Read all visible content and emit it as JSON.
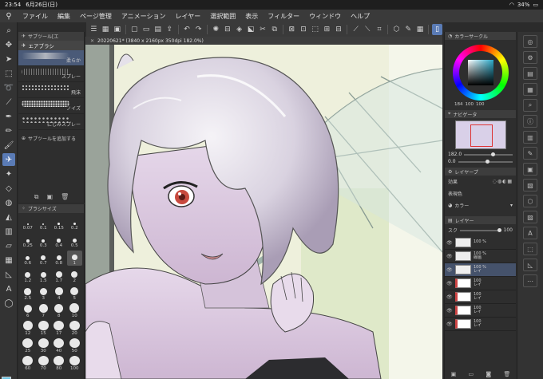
{
  "status": {
    "time": "23:54",
    "date": "6月26日(日)",
    "battery": "34%"
  },
  "menu": [
    "ファイル",
    "編集",
    "ページ管理",
    "アニメーション",
    "レイヤー",
    "選択範囲",
    "表示",
    "フィルター",
    "ウィンドウ",
    "ヘルプ"
  ],
  "subtool": {
    "header": "サブツール[エ",
    "group": "エアブラシ",
    "brushes": [
      {
        "label": "柔らか",
        "selected": true
      },
      {
        "label": "スプレー",
        "selected": false
      },
      {
        "label": "飛沫",
        "selected": false
      },
      {
        "label": "ノイズ",
        "selected": false
      },
      {
        "label": "にじみスプレー",
        "selected": false
      }
    ],
    "add_label": "サブツールを追加する"
  },
  "brush_size": {
    "header": "ブラシサイズ",
    "sizes": [
      "0.07",
      "0.1",
      "0.15",
      "0.2",
      "0.25",
      "0.3",
      "0.4",
      "0.5",
      "0.6",
      "0.7",
      "0.8",
      "1",
      "1.2",
      "1.5",
      "1.7",
      "2",
      "2.5",
      "3",
      "4",
      "5",
      "6",
      "7",
      "8",
      "10",
      "12",
      "15",
      "17",
      "20",
      "25",
      "30",
      "40",
      "50",
      "60",
      "70",
      "80",
      "100"
    ],
    "selected": "1"
  },
  "canvas": {
    "tab_title": "20220621* (3840 x 2160px 350dpi 182.0%)"
  },
  "color": {
    "header": "カラーサークル",
    "r": "184",
    "g": "100",
    "b": "100",
    "main_color": "#6ec6e6",
    "sub_color": "#b44ab4"
  },
  "navigator": {
    "header": "ナビゲータ",
    "zoom": "182.0",
    "rotation": "0.0"
  },
  "layer_property": {
    "header": "レイヤープ",
    "effect_label": "効果",
    "expression_label": "表現色",
    "expression_value": "カラー"
  },
  "layers": {
    "header": "レイヤー",
    "blend": "スク",
    "opacity": "100",
    "rows": [
      {
        "pct": "100 %",
        "name": "",
        "thumb": "plain"
      },
      {
        "pct": "100 %",
        "name": "線画",
        "thumb": "plain"
      },
      {
        "pct": "100 %",
        "name": "レイ",
        "thumb": "plain",
        "selected": true
      },
      {
        "pct": "100",
        "name": "レイ",
        "thumb": "red"
      },
      {
        "pct": "100",
        "name": "レイ",
        "thumb": "red"
      },
      {
        "pct": "100",
        "name": "レイ",
        "thumb": "red"
      },
      {
        "pct": "100",
        "name": "レイ",
        "thumb": "red"
      }
    ]
  }
}
